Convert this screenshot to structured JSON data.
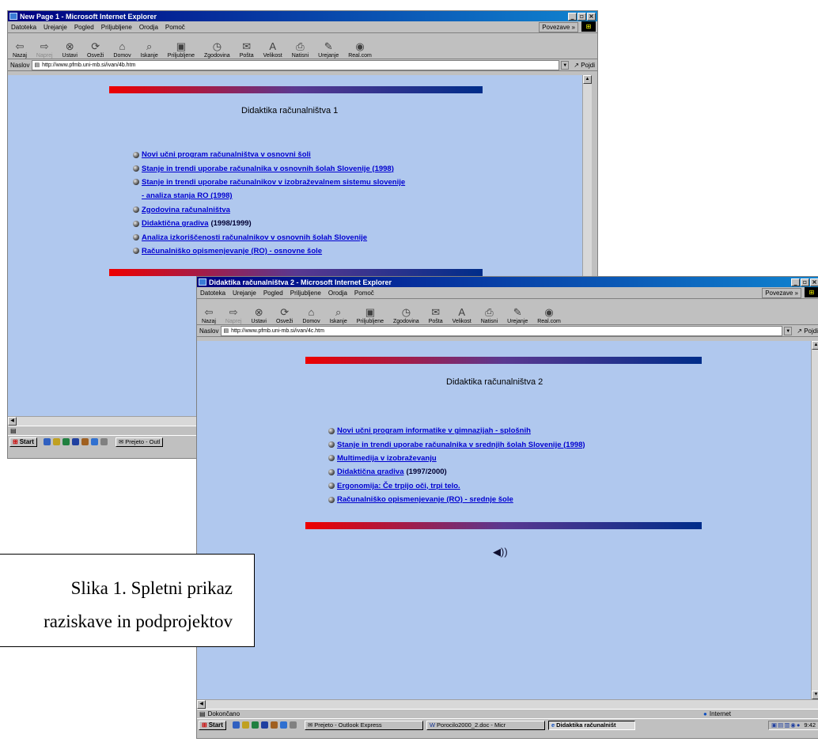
{
  "menu": [
    "Datoteka",
    "Urejanje",
    "Pogled",
    "Priljubljene",
    "Orodja",
    "Pomoč"
  ],
  "links_bar_label": "Povezave »",
  "toolbar_buttons": [
    {
      "label": "Nazaj",
      "icon": "back-arrow-icon",
      "glyph": "⇦",
      "disabled": false
    },
    {
      "label": "Naprej",
      "icon": "forward-arrow-icon",
      "glyph": "⇨",
      "disabled": true
    },
    {
      "label": "Ustavi",
      "icon": "stop-icon",
      "glyph": "⊗",
      "disabled": false
    },
    {
      "label": "Osveži",
      "icon": "refresh-icon",
      "glyph": "⟳",
      "disabled": false
    },
    {
      "label": "Domov",
      "icon": "home-icon",
      "glyph": "⌂",
      "disabled": false
    },
    {
      "label": "Iskanje",
      "icon": "search-icon",
      "glyph": "⌕",
      "disabled": false
    },
    {
      "label": "Priljubljene",
      "icon": "favorites-icon",
      "glyph": "▣",
      "disabled": false
    },
    {
      "label": "Zgodovina",
      "icon": "history-icon",
      "glyph": "◷",
      "disabled": false
    },
    {
      "label": "Pošta",
      "icon": "mail-icon",
      "glyph": "✉",
      "disabled": false
    },
    {
      "label": "Velikost",
      "icon": "font-size-icon",
      "glyph": "A",
      "disabled": false
    },
    {
      "label": "Natisni",
      "icon": "print-icon",
      "glyph": "⎙",
      "disabled": false
    },
    {
      "label": "Urejanje",
      "icon": "edit-icon",
      "glyph": "✎",
      "disabled": false
    },
    {
      "label": "Real.com",
      "icon": "realcom-icon",
      "glyph": "◉",
      "disabled": false
    }
  ],
  "address_label": "Naslov",
  "go_label": "Pojdi",
  "window1": {
    "title": "New Page 1 - Microsoft Internet Explorer",
    "url": "http://www.pfmb.uni-mb.si/ivan/4b.htm",
    "heading": "Didaktika računalništva 1",
    "links": [
      {
        "text": "Novi učni program računalništva v osnovni šoli",
        "suffix": ""
      },
      {
        "text": "Stanje in trendi uporabe računalnika v osnovnih šolah Slovenije (1998)",
        "suffix": ""
      },
      {
        "text": "Stanje in trendi uporabe računalnikov v izobraževalnem sistemu slovenije",
        "suffix": "",
        "continuation": "- analiza stanja RO (1998)"
      },
      {
        "text": "Zgodovina računalništva",
        "suffix": ""
      },
      {
        "text": "Didaktična gradiva",
        "suffix": "(1998/1999)"
      },
      {
        "text": "Analiza izkoriščenosti računalnikov v osnovnih šolah Slovenije",
        "suffix": ""
      },
      {
        "text": "Računalniško opismenjevanje (RO) - osnovne šole",
        "suffix": ""
      }
    ],
    "taskbar": {
      "start": "Start",
      "item": "Prejeto - Outl"
    }
  },
  "window2": {
    "title": "Didaktika računalništva 2 - Microsoft Internet Explorer",
    "url": "http://www.pfmb.uni-mb.si/ivan/4c.htm",
    "heading": "Didaktika računalništva 2",
    "links": [
      {
        "text": "Novi učni program informatike v gimnazijah - splošnih",
        "suffix": ""
      },
      {
        "text": "Stanje in trendi uporabe računalnika v srednjih šolah Slovenije (1998)",
        "suffix": ""
      },
      {
        "text": "Multimedija v izobraževanju",
        "suffix": ""
      },
      {
        "text": "Didaktična gradiva",
        "suffix": "(1997/2000)"
      },
      {
        "text": "Ergonomija: Če trpijo oči, trpi telo.",
        "suffix": ""
      },
      {
        "text": "Računalniško opismenjevanje (RO) - srednje šole",
        "suffix": ""
      }
    ],
    "status": "Dokončano",
    "zone": "Internet",
    "taskbar": {
      "start": "Start",
      "items": [
        "Prejeto - Outlook Express",
        "Porocilo2000_2.doc - Micr",
        "Didaktika računalništ"
      ],
      "clock": "9:42"
    }
  },
  "caption": {
    "line1": "Slika 1. Spletni prikaz",
    "line2": "raziskave in podprojektov"
  }
}
